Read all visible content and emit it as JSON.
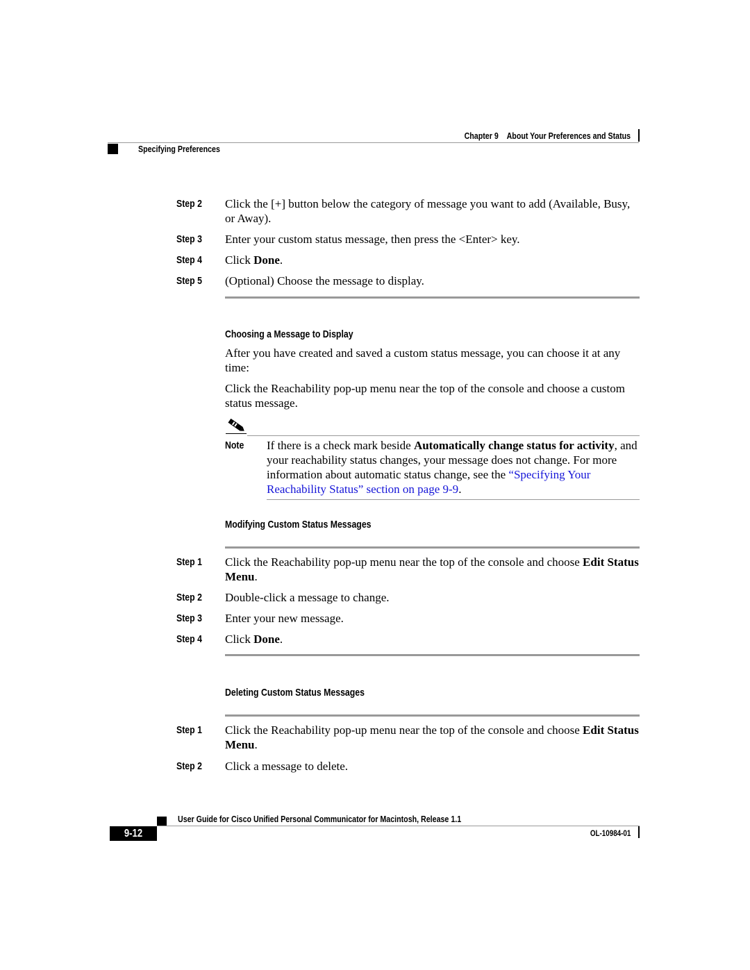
{
  "header": {
    "chapter": "Chapter 9",
    "chapter_title": "About Your Preferences and Status",
    "section": "Specifying Preferences"
  },
  "procedure_add": {
    "steps": [
      {
        "label": "Step 2",
        "text": "Click the [+] button below the category of message you want to add (Available, Busy, or Away)."
      },
      {
        "label": "Step 3",
        "text": "Enter your custom status message, then press the <Enter> key."
      },
      {
        "label": "Step 4",
        "text_before": "Click ",
        "bold": "Done",
        "text_after": "."
      },
      {
        "label": "Step 5",
        "text": "(Optional) Choose the message to display."
      }
    ]
  },
  "choosing": {
    "heading": "Choosing a Message to Display",
    "para1": "After you have created and saved a custom status message, you can choose it at any time:",
    "para2": "Click the Reachability pop-up menu near the top of the console and choose a custom status message."
  },
  "note": {
    "icon": "pencil-note-icon",
    "label": "Note",
    "text_before": "If there is a check mark beside ",
    "bold": "Automatically change status for activity",
    "text_middle": ", and your reachability status changes, your message does not change. For more information about automatic status change, see the ",
    "link": "“Specifying Your Reachability Status” section on page 9-9",
    "text_after": "."
  },
  "modifying": {
    "heading": "Modifying Custom Status Messages",
    "steps": [
      {
        "label": "Step 1",
        "text_before": "Click the Reachability pop-up menu near the top of the console and choose ",
        "bold": "Edit Status Menu",
        "text_after": "."
      },
      {
        "label": "Step 2",
        "text": "Double-click a message to change."
      },
      {
        "label": "Step 3",
        "text": "Enter your new message."
      },
      {
        "label": "Step 4",
        "text_before": "Click ",
        "bold": "Done",
        "text_after": "."
      }
    ]
  },
  "deleting": {
    "heading": "Deleting Custom Status Messages",
    "steps": [
      {
        "label": "Step 1",
        "text_before": "Click the Reachability pop-up menu near the top of the console and choose ",
        "bold": "Edit Status Menu",
        "text_after": "."
      },
      {
        "label": "Step 2",
        "text": "Click a message to delete."
      }
    ]
  },
  "footer": {
    "title": "User Guide for Cisco Unified Personal Communicator for Macintosh, Release 1.1",
    "page_number": "9-12",
    "doc_number": "OL-10984-01"
  }
}
